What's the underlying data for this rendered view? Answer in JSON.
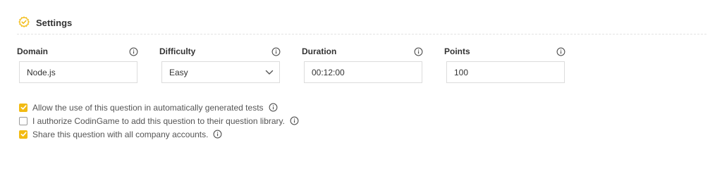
{
  "section": {
    "title": "Settings",
    "icon": "gear-check-icon",
    "accent": "#f2bb13"
  },
  "fields": [
    {
      "label": "Domain",
      "value": "Node.js",
      "type": "text"
    },
    {
      "label": "Difficulty",
      "value": "Easy",
      "type": "select"
    },
    {
      "label": "Duration",
      "value": "00:12:00",
      "type": "text"
    },
    {
      "label": "Points",
      "value": "100",
      "type": "text"
    }
  ],
  "options": [
    {
      "label": "Allow the use of this question in automatically generated tests",
      "checked": true,
      "info": true
    },
    {
      "label": "I authorize CodinGame to add this question to their question library.",
      "checked": false,
      "info": true
    },
    {
      "label": "Share this question with all company accounts.",
      "checked": true,
      "info": true
    }
  ]
}
